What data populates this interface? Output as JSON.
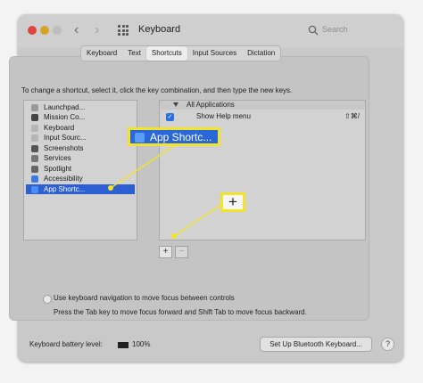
{
  "window": {
    "title": "Keyboard",
    "search_placeholder": "Search"
  },
  "tabs": [
    {
      "label": "Keyboard",
      "selected": false
    },
    {
      "label": "Text",
      "selected": false
    },
    {
      "label": "Shortcuts",
      "selected": true
    },
    {
      "label": "Input Sources",
      "selected": false
    },
    {
      "label": "Dictation",
      "selected": false
    }
  ],
  "instructions": "To change a shortcut, select it, click the key combination, and then type the new keys.",
  "categories": [
    {
      "label": "Launchpad...",
      "icon": "launchpad-icon"
    },
    {
      "label": "Mission Co...",
      "icon": "mission-control-icon"
    },
    {
      "label": "Keyboard",
      "icon": "keyboard-icon"
    },
    {
      "label": "Input Sourc...",
      "icon": "input-sources-icon"
    },
    {
      "label": "Screenshots",
      "icon": "screenshots-icon"
    },
    {
      "label": "Services",
      "icon": "services-icon"
    },
    {
      "label": "Spotlight",
      "icon": "spotlight-icon"
    },
    {
      "label": "Accessibility",
      "icon": "accessibility-icon"
    },
    {
      "label": "App Shortc...",
      "icon": "app-shortcuts-icon",
      "selected": true
    }
  ],
  "shortcuts": {
    "group_label": "All Applications",
    "item_label": "Show Help menu",
    "item_key": "⇧⌘/",
    "item_checked": true
  },
  "buttons": {
    "add": "+",
    "remove": "−"
  },
  "callouts": {
    "app_shortcuts": "App Shortc...",
    "plus": "+"
  },
  "keyboard_nav": {
    "label": "Use keyboard navigation to move focus between controls",
    "hint": "Press the Tab key to move focus forward and Shift Tab to move focus backward."
  },
  "footer": {
    "battery_label": "Keyboard battery level:",
    "battery_percent": "100%",
    "bluetooth_button": "Set Up Bluetooth Keyboard...",
    "help": "?"
  },
  "colors": {
    "accent": "#2c5fd1",
    "callout_border": "#f4e32b"
  }
}
